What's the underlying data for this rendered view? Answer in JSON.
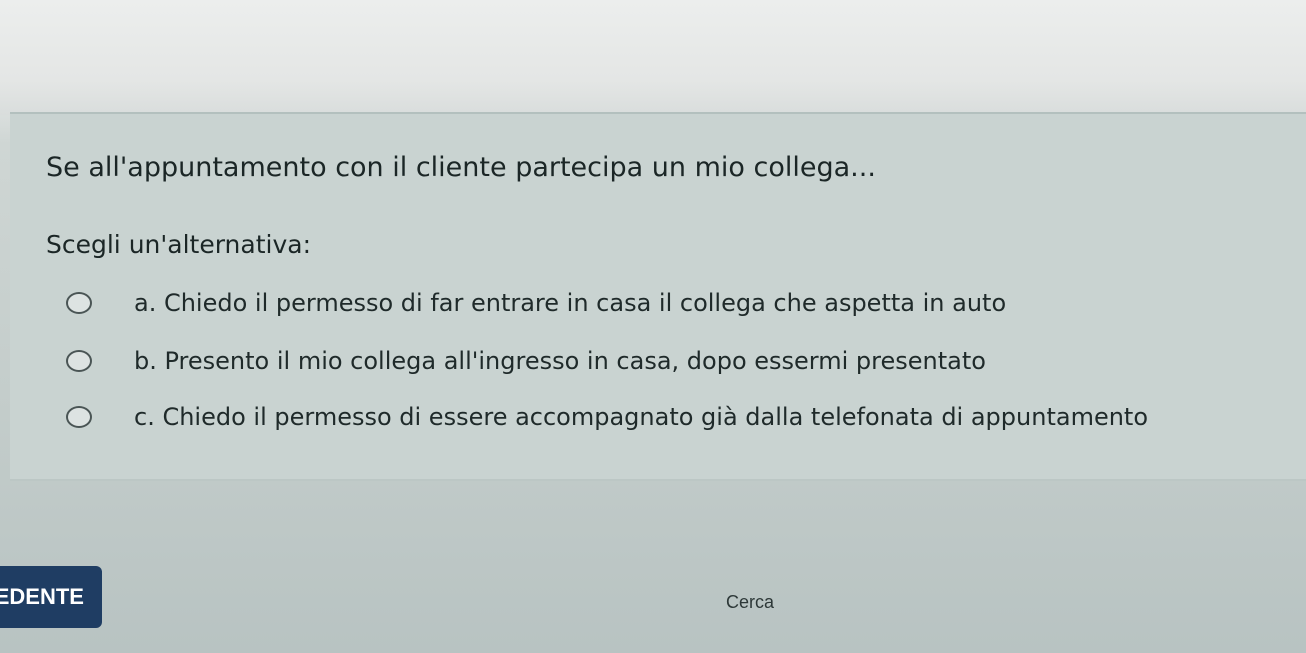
{
  "question": {
    "text": "Se all'appuntamento con il cliente partecipa un mio collega...",
    "instruction": "Scegli un'alternativa:"
  },
  "options": [
    {
      "label": "a. Chiedo il permesso di far entrare in casa il collega che aspetta in auto"
    },
    {
      "label": "b. Presento il mio collega all'ingresso in casa, dopo essermi presentato"
    },
    {
      "label": "c. Chiedo il permesso di essere accompagnato già dalla telefonata di appuntamento"
    }
  ],
  "footer": {
    "prev_label": "EDENTE",
    "search_label": "Cerca"
  },
  "colors": {
    "card_background": "#c9d3d1",
    "button_background": "#1f3d63"
  }
}
